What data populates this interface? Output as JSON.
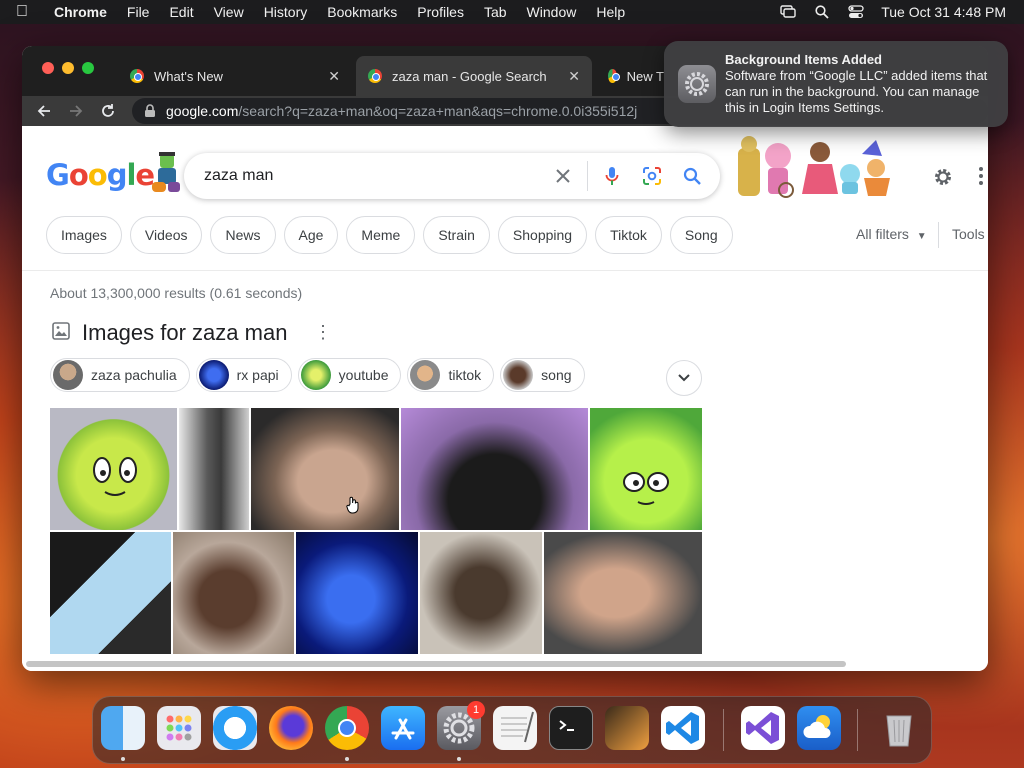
{
  "menubar": {
    "app_name": "Chrome",
    "menus": [
      "File",
      "Edit",
      "View",
      "History",
      "Bookmarks",
      "Profiles",
      "Tab",
      "Window",
      "Help"
    ],
    "clock": "Tue Oct 31  4:48 PM"
  },
  "tabs": [
    {
      "title": "What's New",
      "active": false
    },
    {
      "title": "zaza man - Google Search",
      "active": true
    },
    {
      "title": "New T",
      "active": false
    }
  ],
  "address_bar": {
    "host": "google.com",
    "path": "/search?q=zaza+man&oq=zaza+man&aqs=chrome.0.0i355i512j"
  },
  "search": {
    "logo_text": "Google",
    "query": "zaza man"
  },
  "filter_chips": [
    "Images",
    "Videos",
    "News",
    "Age",
    "Meme",
    "Strain",
    "Shopping",
    "Tiktok",
    "Song"
  ],
  "all_filters_label": "All filters",
  "tools_label": "Tools",
  "result_stats": "About 13,300,000 results (0.61 seconds)",
  "images_section": {
    "title": "Images for zaza man",
    "related": [
      "zaza pachulia",
      "rx papi",
      "youtube",
      "tiktok",
      "song"
    ]
  },
  "notification": {
    "title": "Background Items Added",
    "body": "Software from “Google LLC” added items that can run in the background. You can manage this in Login Items Settings."
  },
  "dock": {
    "apps": [
      "finder-icon",
      "launchpad-icon",
      "safari-icon",
      "firefox-icon",
      "chrome-icon",
      "app-store-icon",
      "system-settings-icon",
      "textedit-icon",
      "terminal-icon",
      "garageband-icon",
      "vscode-icon",
      "visual-studio-icon",
      "weather-icon",
      "trash-icon"
    ],
    "settings_badge": "1"
  },
  "colors": {
    "google_blue": "#4285f4",
    "google_red": "#ea4335",
    "google_yellow": "#fbbc05",
    "google_green": "#34a853",
    "notification_bg": "#404042"
  }
}
